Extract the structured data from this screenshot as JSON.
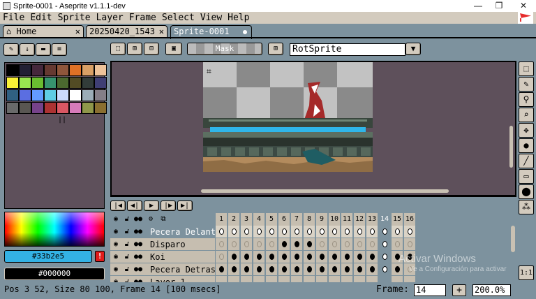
{
  "window": {
    "title": "Sprite-0001 - Aseprite v1.1.1-dev",
    "min": "—",
    "max": "❐",
    "close": "✕"
  },
  "menu": {
    "file": "File",
    "edit": "Edit",
    "sprite": "Sprite",
    "layer": "Layer",
    "frame": "Frame",
    "select": "Select",
    "view": "View",
    "help": "Help"
  },
  "tabs": [
    {
      "label": "Home",
      "close": "✕"
    },
    {
      "label": "20250420_1543",
      "close": "✕"
    },
    {
      "label": "Sprite-0001"
    }
  ],
  "toolbar": {
    "mask_label": "Mask",
    "resize_method": "RotSprite"
  },
  "palette": {
    "colors": [
      "#000000",
      "#222034",
      "#45283c",
      "#663931",
      "#8f563b",
      "#df7126",
      "#d9a066",
      "#eec39a",
      "#fbf236",
      "#99e550",
      "#6abe30",
      "#37946e",
      "#4b692f",
      "#524b24",
      "#323c39",
      "#3f3f74",
      "#306082",
      "#5b6ee1",
      "#639bff",
      "#5fcde4",
      "#cbdbfc",
      "#ffffff",
      "#9badb7",
      "#847e87",
      "#696a6a",
      "#595652",
      "#76428a",
      "#ac3232",
      "#d95763",
      "#d77bba",
      "#8f974a",
      "#8a6f30"
    ]
  },
  "colors": {
    "fg": "#33b2e5",
    "bg": "#000000",
    "fg_swatch": "#33b2e5",
    "bg_swatch": "#000000",
    "warn": "!"
  },
  "tools": [
    "marquee-tool",
    "pencil-tool",
    "eyedropper-tool",
    "zoom-tool",
    "move-tool",
    "fill-tool",
    "line-tool",
    "rectangle-tool",
    "ellipse-tool",
    "spray-tool"
  ],
  "layers": [
    {
      "name": "Pecera Delante",
      "selected": true
    },
    {
      "name": "Disparo"
    },
    {
      "name": "Koi"
    },
    {
      "name": "Pecera Detras"
    },
    {
      "name": "Layer 1"
    }
  ],
  "frames": [
    "1",
    "2",
    "3",
    "4",
    "5",
    "6",
    "7",
    "8",
    "9",
    "10",
    "11",
    "12",
    "13",
    "14",
    "15",
    "16"
  ],
  "current_frame_index": 13,
  "cels": [
    [
      "w",
      "w",
      "w",
      "w",
      "w",
      "w",
      "w",
      "w",
      "w",
      "w",
      "w",
      "w",
      "w",
      "w",
      "w",
      "w"
    ],
    [
      "e",
      "e",
      "e",
      "e",
      "e",
      "f",
      "f",
      "f",
      "e",
      "e",
      "e",
      "e",
      "e",
      "w",
      "e",
      "e"
    ],
    [
      "e",
      "f",
      "f",
      "f",
      "f",
      "f",
      "f",
      "f",
      "f",
      "f",
      "f",
      "f",
      "f",
      "w",
      "f",
      "f"
    ],
    [
      "f",
      "f",
      "f",
      "f",
      "f",
      "f",
      "f",
      "f",
      "f",
      "f",
      "f",
      "f",
      "f",
      "w",
      "f",
      "e"
    ]
  ],
  "status": {
    "text": "Pos 3 52, Size 80 100, Frame 14 [100 msecs]",
    "frame_label": "Frame:",
    "frame_value": "14",
    "plus": "+",
    "zoom": "200.0%"
  },
  "watermark": {
    "line1": "Activar Windows",
    "line2": "Ve a Configuración para activar"
  }
}
